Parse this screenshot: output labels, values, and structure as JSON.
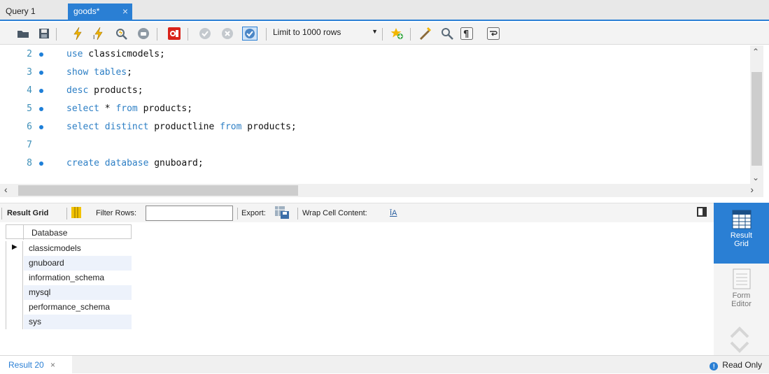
{
  "tabs": [
    {
      "label": "Query 1",
      "active": false
    },
    {
      "label": "goods*",
      "active": true,
      "close": "×"
    }
  ],
  "toolbar": {
    "limit_select": "Limit to 1000 rows",
    "icons": [
      "open-folder-icon",
      "save-icon",
      "execute-icon",
      "execute-statement-icon",
      "explain-icon",
      "stop-icon",
      "toggle-results-icon",
      "commit-icon",
      "rollback-icon",
      "autocommit-icon",
      "beautify-icon",
      "find-icon",
      "invisible-chars-icon",
      "wrap-icon"
    ]
  },
  "editor": {
    "lines": [
      {
        "num": "2",
        "dot": true,
        "segments": [
          {
            "t": "use",
            "kw": true
          },
          {
            "t": " classicmodels;",
            "kw": false
          }
        ]
      },
      {
        "num": "3",
        "dot": true,
        "segments": [
          {
            "t": "show tables",
            "kw": true
          },
          {
            "t": ";",
            "kw": false
          }
        ]
      },
      {
        "num": "4",
        "dot": true,
        "segments": [
          {
            "t": "desc",
            "kw": true
          },
          {
            "t": " products;",
            "kw": false
          }
        ]
      },
      {
        "num": "5",
        "dot": true,
        "segments": [
          {
            "t": "select",
            "kw": true
          },
          {
            "t": " * ",
            "kw": false
          },
          {
            "t": "from",
            "kw": true
          },
          {
            "t": " products;",
            "kw": false
          }
        ]
      },
      {
        "num": "6",
        "dot": true,
        "segments": [
          {
            "t": "select distinct",
            "kw": true
          },
          {
            "t": " productline ",
            "kw": false
          },
          {
            "t": "from",
            "kw": true
          },
          {
            "t": " products;",
            "kw": false
          }
        ]
      },
      {
        "num": "7",
        "dot": false,
        "segments": []
      },
      {
        "num": "8",
        "dot": true,
        "segments": [
          {
            "t": "create database",
            "kw": true
          },
          {
            "t": " gnuboard;",
            "kw": false
          }
        ]
      }
    ]
  },
  "results_toolbar": {
    "result_grid": "Result Grid",
    "filter_rows": "Filter Rows:",
    "filter_value": "",
    "export": "Export:",
    "wrap": "Wrap Cell Content:",
    "wrap_icon_text": "ĪA"
  },
  "grid": {
    "column": "Database",
    "rows": [
      "classicmodels",
      "gnuboard",
      "information_schema",
      "mysql",
      "performance_schema",
      "sys"
    ]
  },
  "side_panel": {
    "result_grid": [
      "Result",
      "Grid"
    ],
    "form_editor": [
      "Form",
      "Editor"
    ]
  },
  "status": {
    "result_tab": "Result 20",
    "result_close": "×",
    "read_only": "Read Only",
    "info_glyph": "!"
  },
  "colors": {
    "accent": "#2a7fd4",
    "keyword": "#2d7fc5",
    "line_number": "#3d8fb8"
  }
}
